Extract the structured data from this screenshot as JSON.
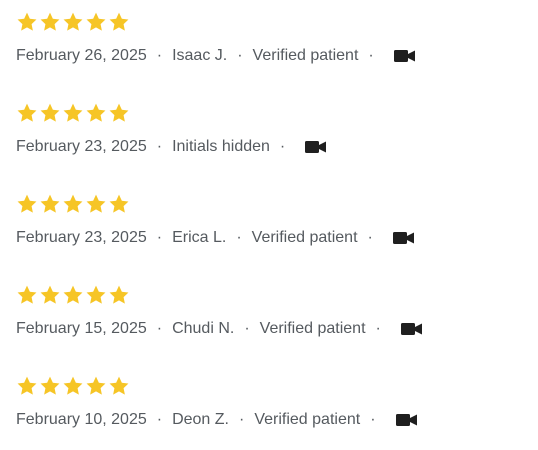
{
  "colors": {
    "star": "#F6C526",
    "meta_text": "#555A5F",
    "video_icon": "#1F1F1F"
  },
  "reviews": [
    {
      "rating": 5,
      "date": "February 26, 2025",
      "author": "Isaac J.",
      "verified": "Verified patient",
      "icon": "video-camera-icon"
    },
    {
      "rating": 5,
      "date": "February 23, 2025",
      "author": "Initials hidden",
      "verified": "",
      "icon": "video-camera-icon"
    },
    {
      "rating": 5,
      "date": "February 23, 2025",
      "author": "Erica L.",
      "verified": "Verified patient",
      "icon": "video-camera-icon"
    },
    {
      "rating": 5,
      "date": "February 15, 2025",
      "author": "Chudi N.",
      "verified": "Verified patient",
      "icon": "video-camera-icon"
    },
    {
      "rating": 5,
      "date": "February 10, 2025",
      "author": "Deon Z.",
      "verified": "Verified patient",
      "icon": "video-camera-icon"
    }
  ]
}
